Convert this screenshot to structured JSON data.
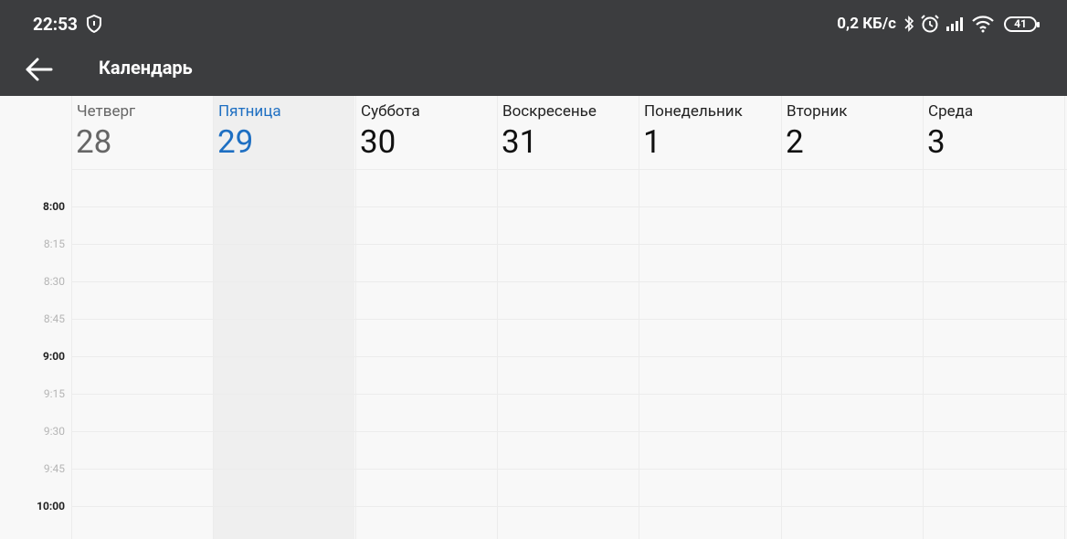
{
  "status_bar": {
    "time": "22:53",
    "network_speed": "0,2 КБ/с",
    "battery_level": "41",
    "icons": [
      "shield-icon",
      "bluetooth-icon",
      "alarm-icon",
      "signal-icon",
      "wifi-icon",
      "battery-icon"
    ]
  },
  "app_bar": {
    "back_icon": "arrow-left-icon",
    "title": "Календарь"
  },
  "week": {
    "today_index": 1,
    "days": [
      {
        "name": "Четверг",
        "number": "28",
        "state": "past"
      },
      {
        "name": "Пятница",
        "number": "29",
        "state": "today"
      },
      {
        "name": "Суббота",
        "number": "30",
        "state": "future"
      },
      {
        "name": "Воскресенье",
        "number": "31",
        "state": "future"
      },
      {
        "name": "Понедельник",
        "number": "1",
        "state": "future"
      },
      {
        "name": "Вторник",
        "number": "2",
        "state": "future"
      },
      {
        "name": "Среда",
        "number": "3",
        "state": "future"
      }
    ]
  },
  "time_slots": [
    {
      "label": "8:00",
      "hour": true
    },
    {
      "label": "8:15",
      "hour": false
    },
    {
      "label": "8:30",
      "hour": false
    },
    {
      "label": "8:45",
      "hour": false
    },
    {
      "label": "9:00",
      "hour": true
    },
    {
      "label": "9:15",
      "hour": false
    },
    {
      "label": "9:30",
      "hour": false
    },
    {
      "label": "9:45",
      "hour": false
    },
    {
      "label": "10:00",
      "hour": true
    }
  ],
  "colors": {
    "bar_background": "#3c3d3f",
    "today_accent": "#1e6fc2",
    "today_column": "#efefef"
  }
}
